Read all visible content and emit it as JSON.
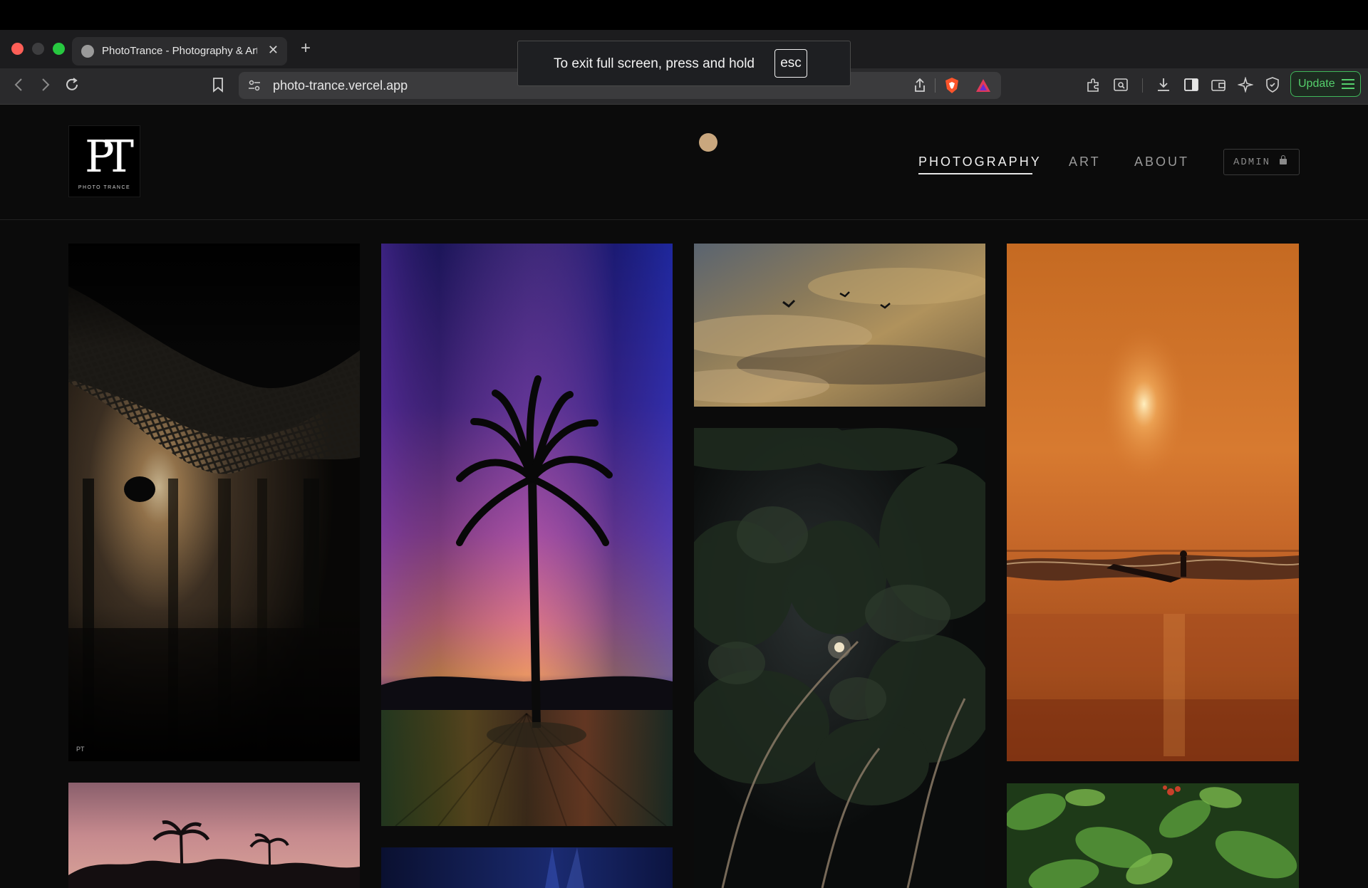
{
  "browser": {
    "tab_title": "PhotoTrance - Photography & Art",
    "new_tab_glyph": "+",
    "close_glyph": "✕",
    "url": "photo-trance.vercel.app",
    "update_label": "Update",
    "icons": [
      "back-icon",
      "forward-icon",
      "reload-icon",
      "bookmark-icon",
      "site-settings-icon",
      "share-icon",
      "brave-shields-icon",
      "brave-rewards-icon",
      "extensions-icon",
      "reader-mode-icon",
      "downloads-icon",
      "sidebar-icon",
      "wallet-icon",
      "leo-ai-icon",
      "vpn-icon",
      "menu-icon"
    ]
  },
  "fullscreen_notice": {
    "text": "To exit full screen, press and hold",
    "key": "esc"
  },
  "site": {
    "logo": {
      "mark": "PT",
      "subtitle": "PHOTO TRANCE"
    },
    "nav": [
      {
        "label": "PHOTOGRAPHY",
        "active": true
      },
      {
        "label": "ART",
        "active": false
      },
      {
        "label": "ABOUT",
        "active": false
      }
    ],
    "admin_label": "ADMIN",
    "admin_icon": "lock-icon"
  },
  "gallery": {
    "watermark": "PT",
    "photos": [
      "net-silhouette-sunset",
      "palm-tree-light-streaks",
      "birds-golden-clouds",
      "moon-through-trees-night",
      "orange-sea-sunset-surfer",
      "palm-silhouettes-pink-sky",
      "blue-night-sky",
      "green-leaves"
    ]
  }
}
